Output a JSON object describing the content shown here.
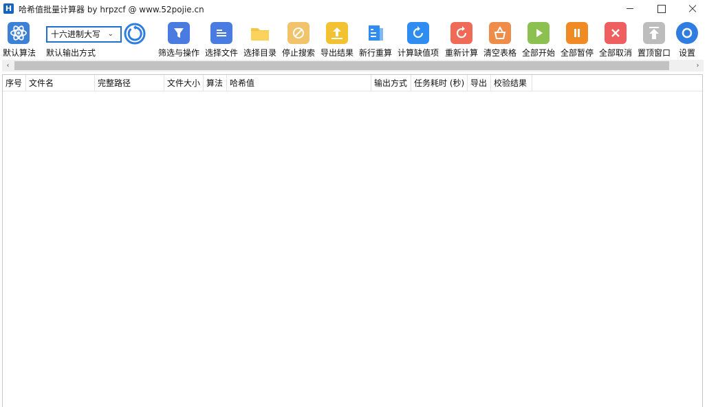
{
  "window": {
    "title": "哈希值批量计算器 by hrpzcf @ www.52pojie.cn",
    "app_icon_letter": "H"
  },
  "toolbar": {
    "default_algorithm": "默认算法",
    "output_mode_selected": "十六进制大写",
    "output_mode_label": "默认输出方式",
    "buttons": [
      {
        "label": "筛选与操作",
        "icon": "filter-icon",
        "color": "#4a7be0"
      },
      {
        "label": "选择文件",
        "icon": "file-icon",
        "color": "#4a7be0"
      },
      {
        "label": "选择目录",
        "icon": "folder-icon",
        "color": "#f7c544"
      },
      {
        "label": "停止搜索",
        "icon": "stop-search-icon",
        "color": "#f1c36a"
      },
      {
        "label": "导出结果",
        "icon": "export-icon",
        "color": "#f3c233"
      },
      {
        "label": "新行重算",
        "icon": "document-list-icon",
        "color": "#2f8cf0"
      },
      {
        "label": "计算缺值项",
        "icon": "refresh-icon",
        "color": "#2f8cf0"
      },
      {
        "label": "重新计算",
        "icon": "recalc-icon",
        "color": "#ef6b57"
      },
      {
        "label": "清空表格",
        "icon": "basket-icon",
        "color": "#ee8c4a"
      },
      {
        "label": "全部开始",
        "icon": "play-icon",
        "color": "#8cc152"
      },
      {
        "label": "全部暂停",
        "icon": "pause-icon",
        "color": "#f08a24"
      },
      {
        "label": "全部取消",
        "icon": "cancel-icon",
        "color": "#ef5f5f"
      },
      {
        "label": "置顶窗口",
        "icon": "pin-top-icon",
        "color": "#bdbdbd"
      },
      {
        "label": "设置",
        "icon": "gear-icon",
        "color": "#2f7de0"
      }
    ]
  },
  "scrollbar": {
    "left_arrow": "‹",
    "right_arrow": "›"
  },
  "table": {
    "columns": [
      "序号",
      "文件名",
      "完整路径",
      "文件大小",
      "算法",
      "哈希值",
      "输出方式",
      "任务耗时 (秒)",
      "导出",
      "校验结果"
    ],
    "rows": []
  }
}
